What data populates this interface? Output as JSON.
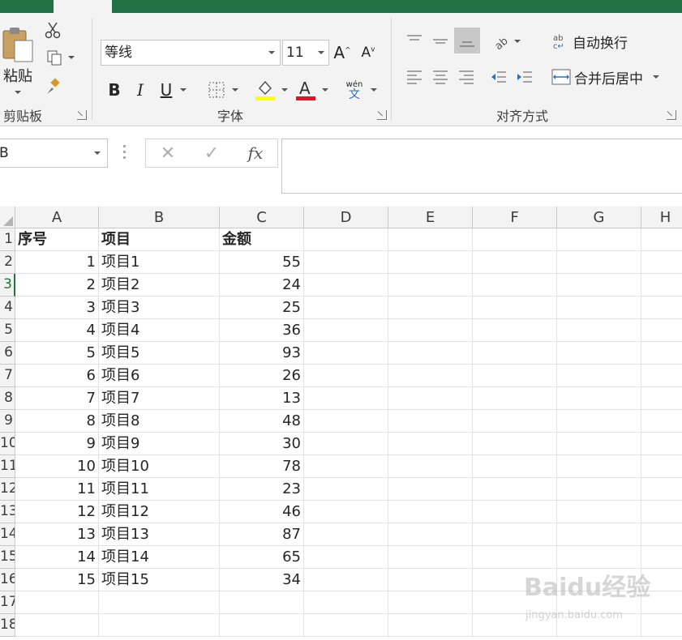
{
  "ribbon": {
    "clipboard": {
      "paste_label": "粘贴",
      "group_label": "剪贴板"
    },
    "font": {
      "font_name": "等线",
      "font_size": "11",
      "bold": "B",
      "italic": "I",
      "underline": "U",
      "phonetic_top": "wén",
      "phonetic_bottom": "文",
      "group_label": "字体",
      "font_color": "#e81123",
      "fill_color": "#ffff00"
    },
    "alignment": {
      "wrap_text": "自动换行",
      "merge_center": "合并后居中",
      "group_label": "对齐方式"
    }
  },
  "formula_bar": {
    "name_box": "B",
    "fx": "fx"
  },
  "sheet": {
    "columns": [
      "A",
      "B",
      "C",
      "D",
      "E",
      "F",
      "G",
      "H"
    ],
    "rows": [
      "1",
      "2",
      "3",
      "4",
      "5",
      "6",
      "7",
      "8",
      "9",
      "10",
      "11",
      "12",
      "13",
      "14",
      "15",
      "16",
      "17",
      "18"
    ],
    "header": [
      "序号",
      "项目",
      "金额"
    ],
    "data": [
      [
        "1",
        "项目1",
        "55"
      ],
      [
        "2",
        "项目2",
        "24"
      ],
      [
        "3",
        "项目3",
        "25"
      ],
      [
        "4",
        "项目4",
        "36"
      ],
      [
        "5",
        "项目5",
        "93"
      ],
      [
        "6",
        "项目6",
        "26"
      ],
      [
        "7",
        "项目7",
        "13"
      ],
      [
        "8",
        "项目8",
        "48"
      ],
      [
        "9",
        "项目9",
        "30"
      ],
      [
        "10",
        "项目10",
        "78"
      ],
      [
        "11",
        "项目11",
        "23"
      ],
      [
        "12",
        "项目12",
        "46"
      ],
      [
        "13",
        "项目13",
        "87"
      ],
      [
        "14",
        "项目14",
        "65"
      ],
      [
        "15",
        "项目15",
        "34"
      ]
    ]
  },
  "watermark": {
    "main": "Baidu经验",
    "sub": "jingyan.baidu.com"
  },
  "colors": {
    "accent": "#217346",
    "ribbon_bg": "#f3f3f3"
  }
}
